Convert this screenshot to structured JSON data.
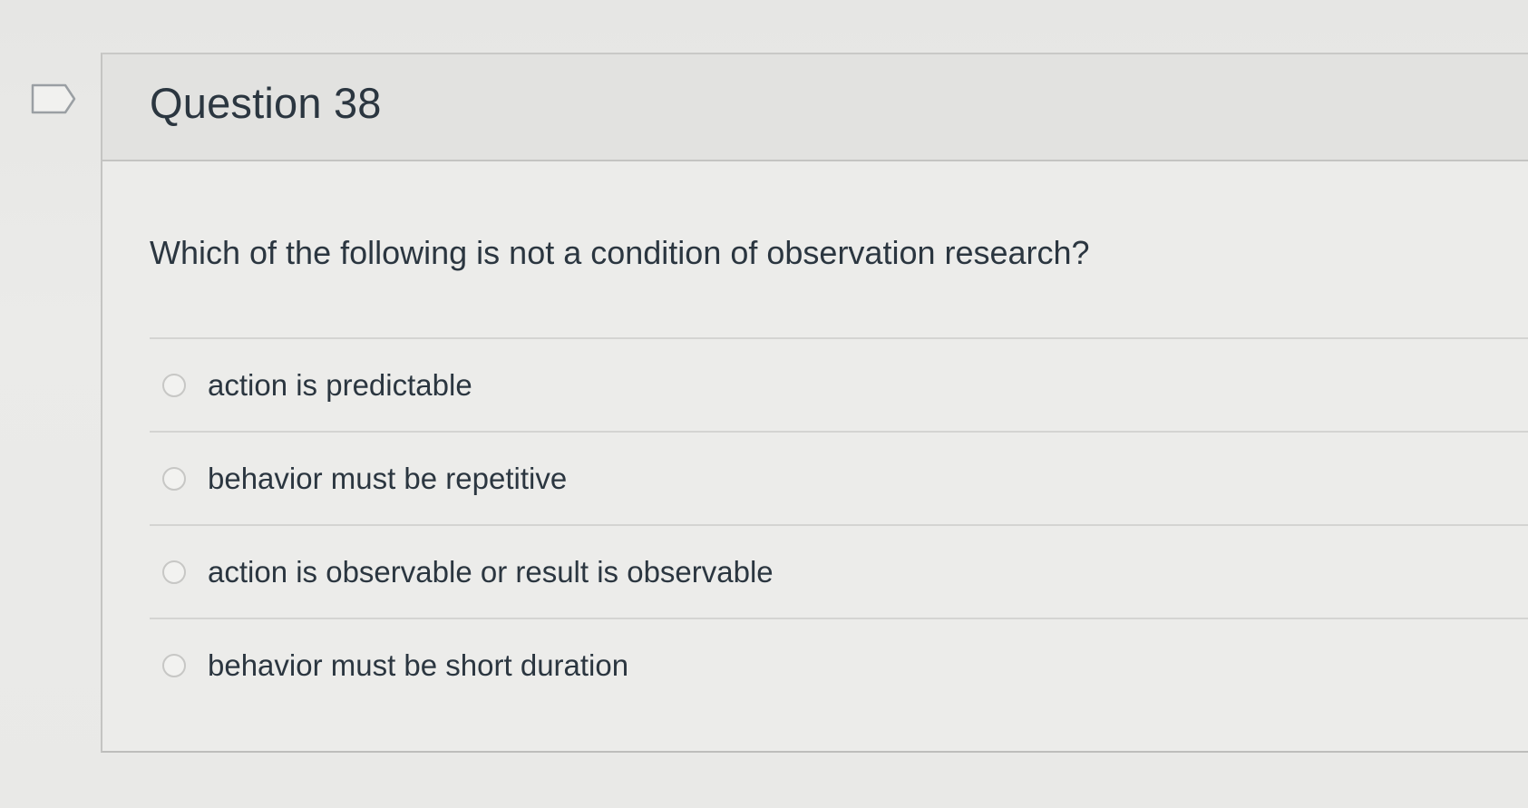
{
  "question": {
    "title": "Question 38",
    "text": "Which of the following is not a condition of observation research?",
    "answers": [
      {
        "label": "action is predictable",
        "selected": false
      },
      {
        "label": "behavior must be repetitive",
        "selected": false
      },
      {
        "label": "action is observable or result is observable",
        "selected": false
      },
      {
        "label": "behavior must be short duration",
        "selected": false
      }
    ]
  },
  "icons": {
    "flag": "flag-question-icon"
  }
}
